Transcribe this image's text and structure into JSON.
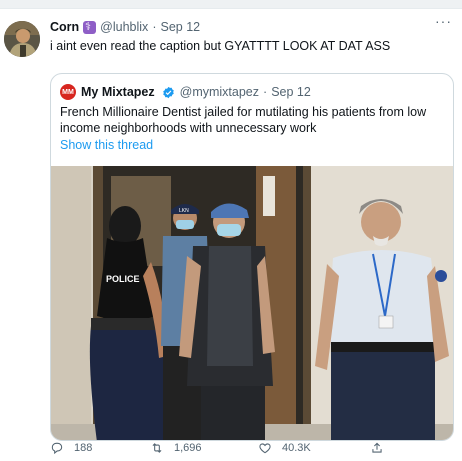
{
  "tweet": {
    "author_name": "Corn",
    "author_handle": "@luhblix",
    "separator": "·",
    "date": "Sep 12",
    "more_glyph": "···",
    "text": "i aint even read the caption but GYATTTT LOOK AT DAT ASS",
    "avatar_icon": "profile-photo"
  },
  "quoted_tweet": {
    "avatar_text": "MM",
    "author_name": "My Mixtapez",
    "verified": true,
    "author_handle": "@mymixtapez",
    "separator": "·",
    "date": "Sep 12",
    "text": "French Millionaire Dentist jailed for mutilating his patients from low income neighborhoods with unnecessary work",
    "show_thread_label": "Show this thread",
    "photo_labels": {
      "police_shirt": "POLICE",
      "cap_text": "LKN"
    }
  },
  "actions": {
    "replies": "188",
    "retweets": "1,696",
    "likes": "40.3K",
    "share": ""
  },
  "colors": {
    "accent": "#1d9bf0",
    "text_primary": "#0f1419",
    "text_secondary": "#536471",
    "border": "#cfd9de",
    "brand_red": "#d7261f"
  }
}
